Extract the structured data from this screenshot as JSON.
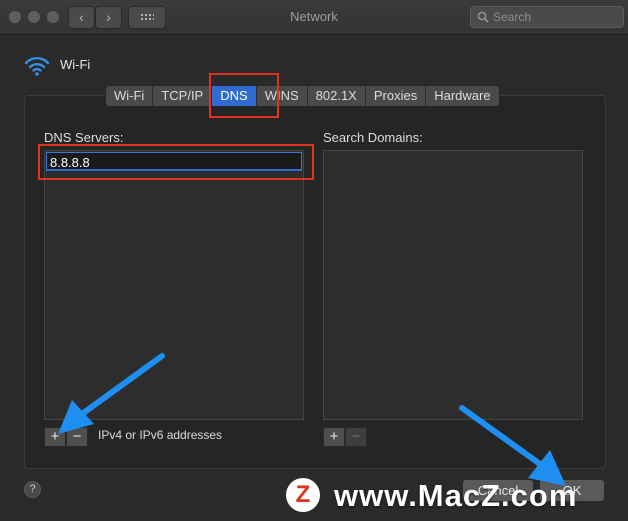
{
  "window": {
    "title": "Network",
    "nav_back": "‹",
    "nav_forward": "›"
  },
  "search": {
    "placeholder": "Search"
  },
  "interface": {
    "name": "Wi-Fi",
    "icon": "wifi-icon"
  },
  "tabs": [
    {
      "label": "Wi-Fi"
    },
    {
      "label": "TCP/IP"
    },
    {
      "label": "DNS",
      "active": true
    },
    {
      "label": "WINS"
    },
    {
      "label": "802.1X"
    },
    {
      "label": "Proxies"
    },
    {
      "label": "Hardware"
    }
  ],
  "dns": {
    "label": "DNS Servers:",
    "servers": [
      "8.8.8.8"
    ],
    "add": "+",
    "remove": "−",
    "hint": "IPv4 or IPv6 addresses"
  },
  "search_domains": {
    "label": "Search Domains:",
    "add": "+",
    "remove": "−"
  },
  "footer": {
    "help": "?",
    "cancel": "Cancel",
    "ok": "OK"
  },
  "watermark": {
    "logo": "Z",
    "text": "www.MacZ.com"
  },
  "colors": {
    "accent": "#2f6bd0",
    "highlight_box": "#e0321e",
    "annotation_arrow": "#1e8ff0"
  }
}
